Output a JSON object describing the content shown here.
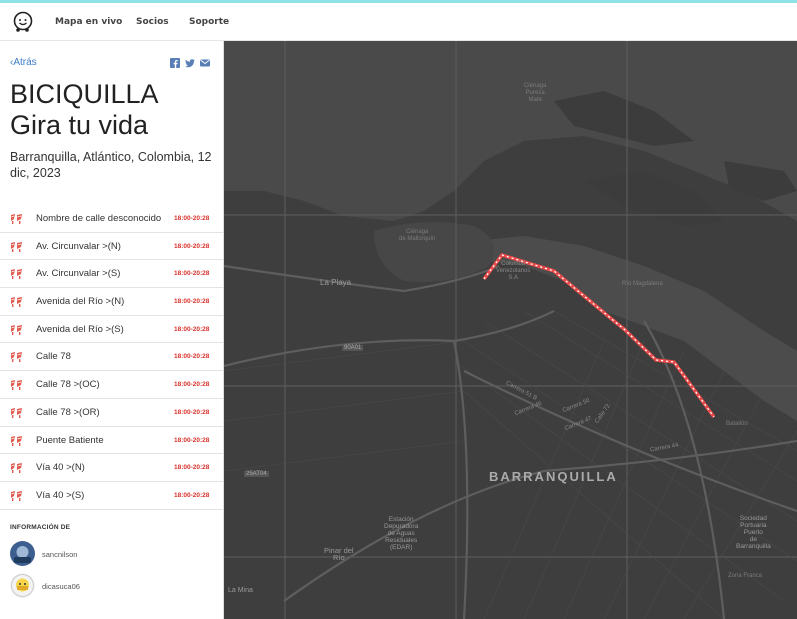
{
  "nav": {
    "logo": "waze-logo-icon",
    "items": [
      "Mapa en vivo",
      "Socios",
      "Soporte"
    ]
  },
  "sidebar": {
    "back_label": "Atrás",
    "share_icons": [
      "facebook-icon",
      "twitter-icon",
      "email-icon"
    ],
    "title_line1": "BICIQUILLA",
    "title_line2": "Gira tu vida",
    "place": "Barranquilla, Atlántico, Colombia, 12 dic, 2023",
    "events": [
      {
        "street": "Nombre de calle desconocido",
        "time": "18:00-20:28"
      },
      {
        "street": "Av. Circunvalar >(N)",
        "time": "18:00-20:28"
      },
      {
        "street": "Av. Circunvalar >(S)",
        "time": "18:00-20:28"
      },
      {
        "street": "Avenida del Río >(N)",
        "time": "18:00-20:28"
      },
      {
        "street": "Avenida del Río >(S)",
        "time": "18:00-20:28"
      },
      {
        "street": "Calle 78",
        "time": "18:00-20:28"
      },
      {
        "street": "Calle 78 >(OC)",
        "time": "18:00-20:28"
      },
      {
        "street": "Calle 78 >(OR)",
        "time": "18:00-20:28"
      },
      {
        "street": "Puente Batiente",
        "time": "18:00-20:28"
      },
      {
        "street": "Vía 40 >(N)",
        "time": "18:00-20:28"
      },
      {
        "street": "Vía 40 >(S)",
        "time": "18:00-20:28"
      }
    ],
    "info_heading": "INFORMACIÓN DE",
    "users": [
      {
        "name": "sancnilson"
      },
      {
        "name": "dicasuca06"
      }
    ]
  },
  "map": {
    "city": "BARRANQUILLA",
    "labels": {
      "cienaga_pureza": "Ciénaga\nPureza\nMate",
      "cienaga_mallorquin": "Ciénaga\nde Mallorquín",
      "la_playa": "La Playa",
      "colombo": "Colombo\nVenezolanos\nS.A",
      "rio_magdalena": "Río Magdalena",
      "carrera51b": "Carrera 51 B",
      "carrera50": "Carrera 50",
      "carrera47": "Carrera 47",
      "carrera46": "Carrera 46",
      "carrera44": "Carrera 44",
      "calle72": "Calle 72",
      "estacion": "Estación\nDepuradora\nde Aguas\nResiduales\n(EDAR)",
      "pinar": "Pinar del\nRío",
      "sociedad": "Sociedad\nPortuaria\nPuerto\nde\nBarranquilla",
      "zona_franca": "Zona Franca",
      "via40": "Vía 40",
      "la_mina": "La Mina",
      "road_90a01": "90A01",
      "road_25at04": "25AT04",
      "batallon": "Batallón"
    },
    "route_color": "#e84a4a",
    "water_color": "#4d4d4d",
    "land_color": "#3a3a3a"
  }
}
